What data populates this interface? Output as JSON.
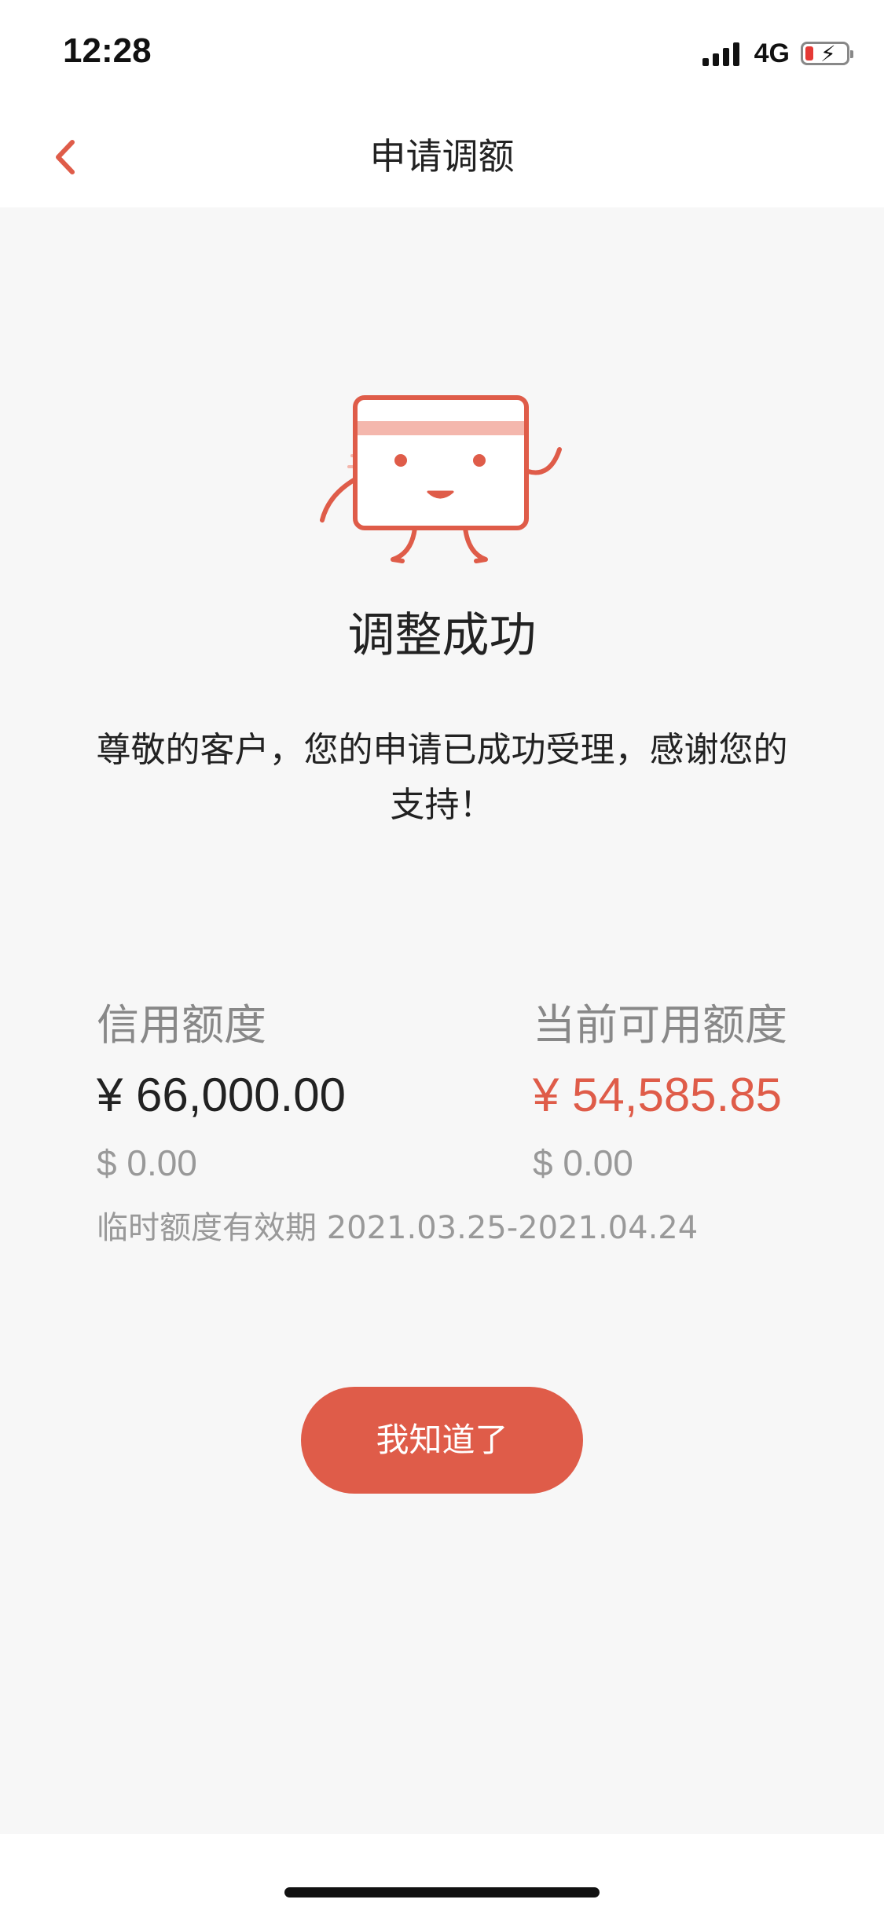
{
  "status_bar": {
    "time": "12:28",
    "network": "4G"
  },
  "nav": {
    "title": "申请调额",
    "back_icon": "chevron-left-icon"
  },
  "result": {
    "title": "调整成功",
    "message": "尊敬的客户，您的申请已成功受理，感谢您的支持！",
    "illustration": "card-mascot-icon"
  },
  "limits": {
    "credit": {
      "label": "信用额度",
      "cny": "¥ 66,000.00",
      "usd": "$ 0.00"
    },
    "available": {
      "label": "当前可用额度",
      "cny": "¥ 54,585.85",
      "usd": "$ 0.00"
    },
    "validity": "临时额度有效期 2021.03.25-2021.04.24"
  },
  "actions": {
    "ok_label": "我知道了"
  },
  "colors": {
    "accent": "#df5c49",
    "background": "#f7f7f7",
    "text": "#222222",
    "muted": "#999999"
  }
}
